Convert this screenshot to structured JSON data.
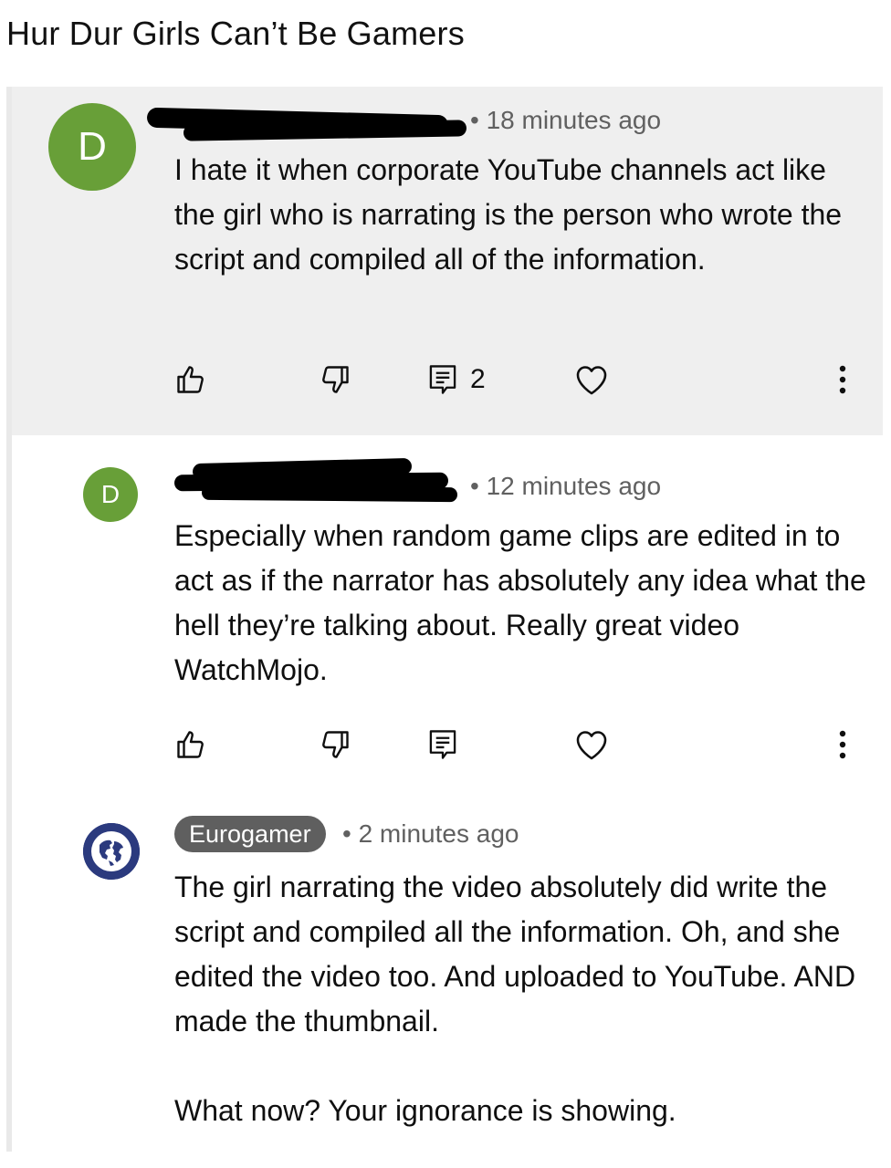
{
  "post_title": "Hur Dur Girls Can’t Be Gamers",
  "colors": {
    "highlight_bg": "#efefef",
    "avatar_green": "#689f38",
    "chip_bg": "#5f5f5f",
    "eurogamer_blue": "#2b3a7e"
  },
  "comments": [
    {
      "avatar_letter": "D",
      "time": "• 18 minutes ago",
      "text": "I hate it when corporate YouTube channels act like the girl who is narrating is the person who wrote the script and compiled all of the information.",
      "reply_count": "2"
    },
    {
      "avatar_letter": "D",
      "time": "• 12 minutes ago",
      "text": "Especially when random game clips are edited in to act as if the narrator has absolutely any idea what the hell they’re talking about. Really great video WatchMojo."
    },
    {
      "author": "Eurogamer",
      "time": "• 2 minutes ago",
      "text": "The girl narrating the video absolutely did write the script and compiled all the information. Oh, and she edited the video too. And uploaded to YouTube. AND made the thumbnail.",
      "text2": "What now? Your ignorance is showing."
    }
  ]
}
